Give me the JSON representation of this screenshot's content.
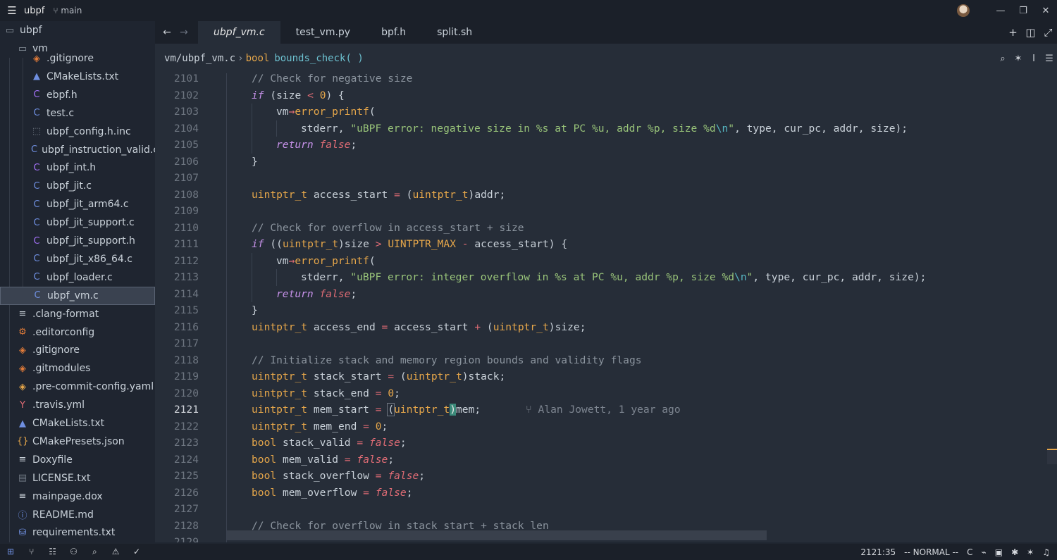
{
  "titlebar": {
    "project": "ubpf",
    "branch": "main",
    "menu_icon": "☰",
    "minimize": "—",
    "restore": "❐",
    "close": "✕"
  },
  "sidebar": {
    "root": "ubpf",
    "folder": "vm",
    "items": [
      {
        "label": ".gitignore",
        "icon": "◈",
        "color": "#e07b39"
      },
      {
        "label": "CMakeLists.txt",
        "icon": "▲",
        "color": "#6f8fe0"
      },
      {
        "label": "ebpf.h",
        "icon": "C",
        "color": "#a371f7"
      },
      {
        "label": "test.c",
        "icon": "C",
        "color": "#6f8fe0"
      },
      {
        "label": "ubpf_config.h.inc",
        "icon": "⬚",
        "color": "#6e7681"
      },
      {
        "label": "ubpf_instruction_valid.c",
        "icon": "C",
        "color": "#6f8fe0"
      },
      {
        "label": "ubpf_int.h",
        "icon": "C",
        "color": "#a371f7"
      },
      {
        "label": "ubpf_jit.c",
        "icon": "C",
        "color": "#6f8fe0"
      },
      {
        "label": "ubpf_jit_arm64.c",
        "icon": "C",
        "color": "#6f8fe0"
      },
      {
        "label": "ubpf_jit_support.c",
        "icon": "C",
        "color": "#6f8fe0"
      },
      {
        "label": "ubpf_jit_support.h",
        "icon": "C",
        "color": "#a371f7"
      },
      {
        "label": "ubpf_jit_x86_64.c",
        "icon": "C",
        "color": "#6f8fe0"
      },
      {
        "label": "ubpf_loader.c",
        "icon": "C",
        "color": "#6f8fe0"
      },
      {
        "label": "ubpf_vm.c",
        "icon": "C",
        "color": "#6f8fe0"
      }
    ],
    "root_items": [
      {
        "label": ".clang-format",
        "icon": "≡",
        "color": "#c9d1d9"
      },
      {
        "label": ".editorconfig",
        "icon": "⚙",
        "color": "#e07b39"
      },
      {
        "label": ".gitignore",
        "icon": "◈",
        "color": "#e07b39"
      },
      {
        "label": ".gitmodules",
        "icon": "◈",
        "color": "#e07b39"
      },
      {
        "label": ".pre-commit-config.yaml",
        "icon": "◈",
        "color": "#e5a64a"
      },
      {
        "label": ".travis.yml",
        "icon": "Y",
        "color": "#e06c75"
      },
      {
        "label": "CMakeLists.txt",
        "icon": "▲",
        "color": "#6f8fe0"
      },
      {
        "label": "CMakePresets.json",
        "icon": "{}",
        "color": "#e5a64a"
      },
      {
        "label": "Doxyfile",
        "icon": "≡",
        "color": "#c9d1d9"
      },
      {
        "label": "LICENSE.txt",
        "icon": "▤",
        "color": "#6e7681"
      },
      {
        "label": "mainpage.dox",
        "icon": "≡",
        "color": "#c9d1d9"
      },
      {
        "label": "README.md",
        "icon": "ⓘ",
        "color": "#6f8fe0"
      },
      {
        "label": "requirements.txt",
        "icon": "⛁",
        "color": "#6f8fe0"
      }
    ]
  },
  "tabs": [
    {
      "label": "ubpf_vm.c",
      "active": true
    },
    {
      "label": "test_vm.py",
      "active": false
    },
    {
      "label": "bpf.h",
      "active": false
    },
    {
      "label": "split.sh",
      "active": false
    }
  ],
  "breadcrumb": {
    "path": "vm/ubpf_vm.c",
    "sep": "›",
    "return_type": "bool",
    "function": "bounds_check( )"
  },
  "editor": {
    "current_line": 2121,
    "blame": "Alan Jowett, 1 year ago",
    "lines": [
      {
        "n": 2101,
        "indent": 1,
        "parts": [
          [
            "t-com",
            "// Check for negative size"
          ]
        ]
      },
      {
        "n": 2102,
        "indent": 1,
        "parts": [
          [
            "t-kw",
            "if"
          ],
          [
            "",
            " (size "
          ],
          [
            "t-op",
            "<"
          ],
          [
            "",
            " "
          ],
          [
            "t-num",
            "0"
          ],
          [
            "",
            ") {"
          ]
        ]
      },
      {
        "n": 2103,
        "indent": 2,
        "parts": [
          [
            "",
            "vm"
          ],
          [
            "t-op",
            "→"
          ],
          [
            "t-fn",
            "error_printf"
          ],
          [
            "",
            "("
          ]
        ]
      },
      {
        "n": 2104,
        "indent": 3,
        "parts": [
          [
            "",
            "stderr, "
          ],
          [
            "t-str",
            "\"uBPF error: negative size in %s at PC %u, addr %p, size %d"
          ],
          [
            "t-esc",
            "\\n"
          ],
          [
            "t-str",
            "\""
          ],
          [
            "",
            ", type, cur_pc, addr, size);"
          ]
        ]
      },
      {
        "n": 2105,
        "indent": 2,
        "parts": [
          [
            "t-kw",
            "return"
          ],
          [
            "",
            " "
          ],
          [
            "t-bool",
            "false"
          ],
          [
            "",
            ";"
          ]
        ]
      },
      {
        "n": 2106,
        "indent": 1,
        "parts": [
          [
            "",
            "}"
          ]
        ]
      },
      {
        "n": 2107,
        "indent": 1,
        "parts": []
      },
      {
        "n": 2108,
        "indent": 1,
        "parts": [
          [
            "t-type",
            "uintptr_t"
          ],
          [
            "",
            " access_start "
          ],
          [
            "t-op",
            "="
          ],
          [
            "",
            " ("
          ],
          [
            "t-type",
            "uintptr_t"
          ],
          [
            "",
            ")addr;"
          ]
        ]
      },
      {
        "n": 2109,
        "indent": 1,
        "parts": []
      },
      {
        "n": 2110,
        "indent": 1,
        "parts": [
          [
            "t-com",
            "// Check for overflow in access_start + size"
          ]
        ]
      },
      {
        "n": 2111,
        "indent": 1,
        "parts": [
          [
            "t-kw",
            "if"
          ],
          [
            "",
            " (("
          ],
          [
            "t-type",
            "uintptr_t"
          ],
          [
            "",
            ")size "
          ],
          [
            "t-op",
            ">"
          ],
          [
            "",
            " "
          ],
          [
            "t-mac",
            "UINTPTR_MAX"
          ],
          [
            "",
            " "
          ],
          [
            "t-op",
            "-"
          ],
          [
            "",
            " access_start) {"
          ]
        ]
      },
      {
        "n": 2112,
        "indent": 2,
        "parts": [
          [
            "",
            "vm"
          ],
          [
            "t-op",
            "→"
          ],
          [
            "t-fn",
            "error_printf"
          ],
          [
            "",
            "("
          ]
        ]
      },
      {
        "n": 2113,
        "indent": 3,
        "parts": [
          [
            "",
            "stderr, "
          ],
          [
            "t-str",
            "\"uBPF error: integer overflow in %s at PC %u, addr %p, size %d"
          ],
          [
            "t-esc",
            "\\n"
          ],
          [
            "t-str",
            "\""
          ],
          [
            "",
            ", type, cur_pc, addr, size);"
          ]
        ]
      },
      {
        "n": 2114,
        "indent": 2,
        "parts": [
          [
            "t-kw",
            "return"
          ],
          [
            "",
            " "
          ],
          [
            "t-bool",
            "false"
          ],
          [
            "",
            ";"
          ]
        ]
      },
      {
        "n": 2115,
        "indent": 1,
        "parts": [
          [
            "",
            "}"
          ]
        ]
      },
      {
        "n": 2116,
        "indent": 1,
        "parts": [
          [
            "t-type",
            "uintptr_t"
          ],
          [
            "",
            " access_end "
          ],
          [
            "t-op",
            "="
          ],
          [
            "",
            " access_start "
          ],
          [
            "t-op",
            "+"
          ],
          [
            "",
            " ("
          ],
          [
            "t-type",
            "uintptr_t"
          ],
          [
            "",
            ")size;"
          ]
        ]
      },
      {
        "n": 2117,
        "indent": 1,
        "parts": []
      },
      {
        "n": 2118,
        "indent": 1,
        "parts": [
          [
            "t-com",
            "// Initialize stack and memory region bounds and validity flags"
          ]
        ]
      },
      {
        "n": 2119,
        "indent": 1,
        "parts": [
          [
            "t-type",
            "uintptr_t"
          ],
          [
            "",
            " stack_start "
          ],
          [
            "t-op",
            "="
          ],
          [
            "",
            " ("
          ],
          [
            "t-type",
            "uintptr_t"
          ],
          [
            "",
            ")stack;"
          ]
        ]
      },
      {
        "n": 2120,
        "indent": 1,
        "parts": [
          [
            "t-type",
            "uintptr_t"
          ],
          [
            "",
            " stack_end "
          ],
          [
            "t-op",
            "="
          ],
          [
            "",
            " "
          ],
          [
            "t-num",
            "0"
          ],
          [
            "",
            ";"
          ]
        ]
      },
      {
        "n": 2121,
        "indent": 1,
        "parts": [
          [
            "t-type",
            "uintptr_t"
          ],
          [
            "",
            " mem_start "
          ],
          [
            "t-op",
            "="
          ],
          [
            "",
            " "
          ],
          [
            "bracket",
            "("
          ],
          [
            "t-type",
            "uintptr_t"
          ],
          [
            "cursor-char",
            ")"
          ],
          [
            "",
            "mem;"
          ]
        ]
      },
      {
        "n": 2122,
        "indent": 1,
        "parts": [
          [
            "t-type",
            "uintptr_t"
          ],
          [
            "",
            " mem_end "
          ],
          [
            "t-op",
            "="
          ],
          [
            "",
            " "
          ],
          [
            "t-num",
            "0"
          ],
          [
            "",
            ";"
          ]
        ]
      },
      {
        "n": 2123,
        "indent": 1,
        "parts": [
          [
            "t-type",
            "bool"
          ],
          [
            "",
            " stack_valid "
          ],
          [
            "t-op",
            "="
          ],
          [
            "",
            " "
          ],
          [
            "t-bool",
            "false"
          ],
          [
            "",
            ";"
          ]
        ]
      },
      {
        "n": 2124,
        "indent": 1,
        "parts": [
          [
            "t-type",
            "bool"
          ],
          [
            "",
            " mem_valid "
          ],
          [
            "t-op",
            "="
          ],
          [
            "",
            " "
          ],
          [
            "t-bool",
            "false"
          ],
          [
            "",
            ";"
          ]
        ]
      },
      {
        "n": 2125,
        "indent": 1,
        "parts": [
          [
            "t-type",
            "bool"
          ],
          [
            "",
            " stack_overflow "
          ],
          [
            "t-op",
            "="
          ],
          [
            "",
            " "
          ],
          [
            "t-bool",
            "false"
          ],
          [
            "",
            ";"
          ]
        ]
      },
      {
        "n": 2126,
        "indent": 1,
        "parts": [
          [
            "t-type",
            "bool"
          ],
          [
            "",
            " mem_overflow "
          ],
          [
            "t-op",
            "="
          ],
          [
            "",
            " "
          ],
          [
            "t-bool",
            "false"
          ],
          [
            "",
            ";"
          ]
        ]
      },
      {
        "n": 2127,
        "indent": 1,
        "parts": []
      },
      {
        "n": 2128,
        "indent": 1,
        "parts": [
          [
            "t-com",
            "// Check for overflow in stack_start + stack_len"
          ]
        ]
      },
      {
        "n": 2129,
        "indent": 1,
        "parts": []
      }
    ]
  },
  "statusbar": {
    "position": "2121:35",
    "mode": "-- NORMAL --",
    "language": "C"
  }
}
